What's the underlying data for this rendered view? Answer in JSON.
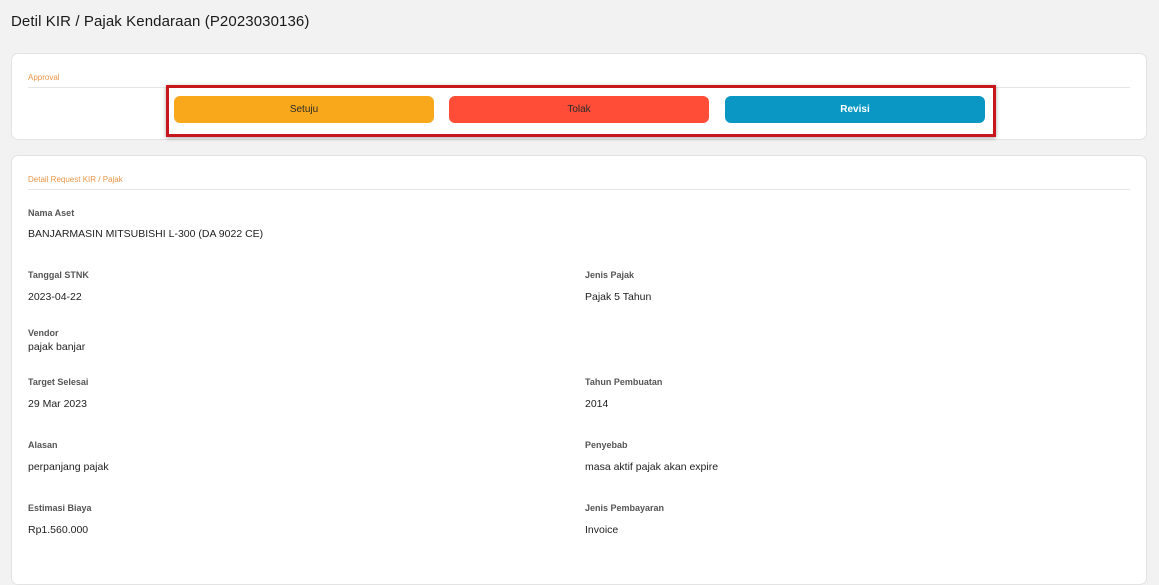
{
  "page": {
    "title": "Detil KIR / Pajak Kendaraan (P2023030136)"
  },
  "approval": {
    "section_label": "Approval",
    "buttons": {
      "setuju": "Setuju",
      "tolak": "Tolak",
      "revisi": "Revisi"
    }
  },
  "detail": {
    "section_label": "Detail Request KIR / Pajak",
    "fields": {
      "nama_aset": {
        "label": "Nama Aset",
        "value": "BANJARMASIN MITSUBISHI L-300 (DA 9022 CE)"
      },
      "tanggal_stnk": {
        "label": "Tanggal STNK",
        "value": "2023-04-22"
      },
      "jenis_pajak": {
        "label": "Jenis Pajak",
        "value": "Pajak 5 Tahun"
      },
      "vendor": {
        "label": "Vendor",
        "value": "pajak banjar"
      },
      "target_selesai": {
        "label": "Target Selesai",
        "value": "29 Mar 2023"
      },
      "tahun_pembuatan": {
        "label": "Tahun Pembuatan",
        "value": "2014"
      },
      "alasan": {
        "label": "Alasan",
        "value": "perpanjang pajak"
      },
      "penyebab": {
        "label": "Penyebab",
        "value": "masa aktif pajak akan expire"
      },
      "estimasi_biaya": {
        "label": "Estimasi Biaya",
        "value": "Rp1.560.000"
      },
      "jenis_pembayaran": {
        "label": "Jenis Pembayaran",
        "value": "Invoice"
      }
    }
  },
  "colors": {
    "setuju_button": "#f9a81c",
    "tolak_button": "#ff4d38",
    "revisi_button": "#0b97c4",
    "section_label": "#e8964a",
    "highlight_border": "#c8161d"
  }
}
